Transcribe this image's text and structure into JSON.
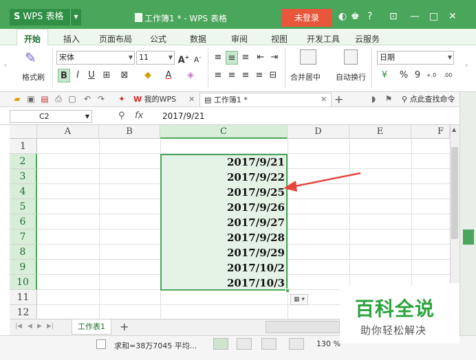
{
  "window": {
    "app_name": "WPS 表格",
    "doc_title": "工作簿1 * - WPS 表格",
    "login_label": "未登录",
    "controls": [
      "?",
      "—",
      "□",
      "✕"
    ]
  },
  "ribbon_tabs": [
    "开始",
    "插入",
    "页面布局",
    "公式",
    "数据",
    "审阅",
    "视图",
    "开发工具",
    "云服务"
  ],
  "ribbon": {
    "format_painter": "格式刷",
    "font_name": "宋体",
    "font_size": "11",
    "merge_center": "合并居中",
    "wrap_text": "自动换行",
    "number_format": "日期",
    "percent": "%",
    "comma": "9",
    "dec_inc": ".00\n+.0",
    "bold": "B",
    "italic": "I",
    "underline": "U"
  },
  "quick_access": {
    "tabs": [
      {
        "label": "我的WPS"
      },
      {
        "label": "工作簿1 *"
      }
    ],
    "search_label": "点此查找命令"
  },
  "formula_bar": {
    "name_box": "C2",
    "fx": "fx",
    "value": "2017/9/21"
  },
  "grid": {
    "columns": [
      "A",
      "B",
      "C",
      "D",
      "E",
      "F"
    ],
    "rows": [
      "1",
      "2",
      "3",
      "4",
      "5",
      "6",
      "7",
      "8",
      "9",
      "10",
      "11",
      "12"
    ],
    "c_values": [
      "2017/9/21",
      "2017/9/22",
      "2017/9/25",
      "2017/9/26",
      "2017/9/27",
      "2017/9/28",
      "2017/9/29",
      "2017/10/2",
      "2017/10/3"
    ]
  },
  "sheet": {
    "tab_label": "工作表1",
    "add_label": "+"
  },
  "status": {
    "sum_text": "求和=38万7045  平均...",
    "zoom": "130 %"
  },
  "watermark": {
    "title": "百科全说",
    "subtitle": "助你轻松解决"
  },
  "colors": {
    "accent": "#4aa65a",
    "login": "#e8563c",
    "arrow": "#e8453c"
  }
}
